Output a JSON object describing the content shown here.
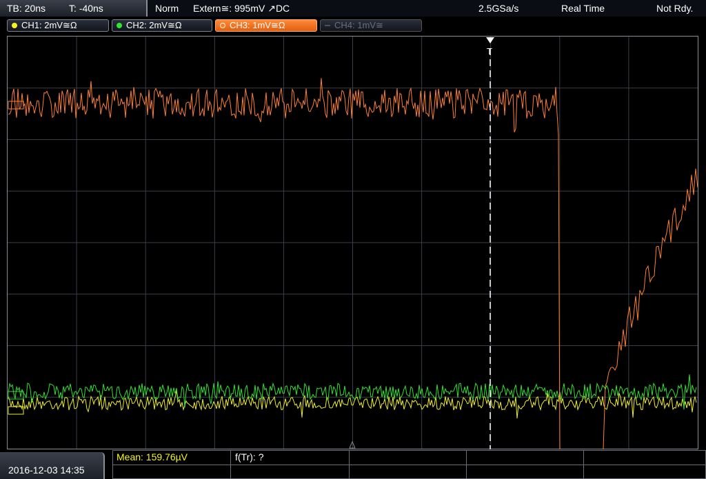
{
  "status": {
    "timebase": "TB: 20ns",
    "trigger_time": "T: -40ns",
    "mode": "Norm",
    "trigger_source": "Extern≅: 995mV ↗DC",
    "sample_rate": "2.5GSa/s",
    "acq_mode": "Real Time",
    "state": "Not Rdy."
  },
  "channels": [
    {
      "label": "CH1: 2mV≅Ω",
      "color": "#f5f51e",
      "state": "on"
    },
    {
      "label": "CH2: 2mV≅Ω",
      "color": "#2ee62e",
      "state": "on"
    },
    {
      "label": "CH3: 1mV≅Ω",
      "color": "#ff7a1e",
      "state": "selected"
    },
    {
      "label": "CH4: 1mV≅",
      "color": "#5a5f68",
      "state": "off"
    }
  ],
  "trigger_marker": "T",
  "datetime": "2016-12-03 14:35",
  "measurements": {
    "mean": "Mean: 159.76µV",
    "rise": "f(Tr): ?"
  },
  "colors": {
    "ch1": "#f0f020",
    "ch2": "#30e030",
    "ch3": "#ff8030",
    "grid": "#3a3f48"
  }
}
